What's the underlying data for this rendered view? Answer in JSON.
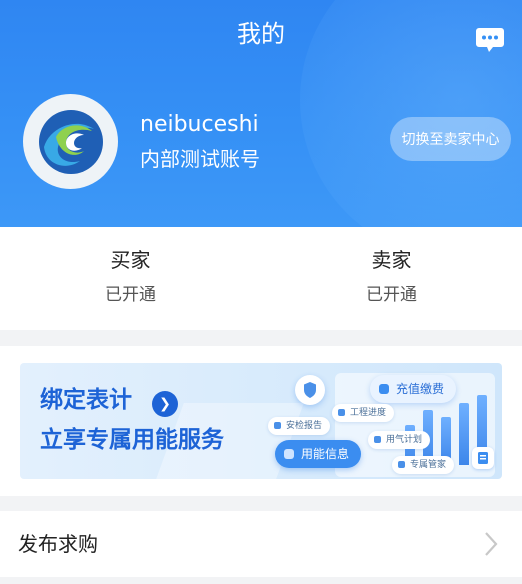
{
  "header": {
    "title": "我的",
    "message_icon": "chat-bubble-icon"
  },
  "profile": {
    "username": "neibuceshi",
    "account_type": "内部测试账号",
    "switch_button_label": "切换至卖家中心",
    "avatar_icon": "company-logo-icon"
  },
  "roles": [
    {
      "name": "买家",
      "status": "已开通"
    },
    {
      "name": "卖家",
      "status": "已开通"
    }
  ],
  "banner": {
    "line1": "绑定表计",
    "line2": "立享专属用能服务",
    "arrow_icon": "chevron-right-icon",
    "tags": {
      "recharge": "充值缴费",
      "safety_report": "安检报告",
      "project_progress": "工程进度",
      "gas_plan": "用气计划",
      "energy_info": "用能信息",
      "dedicated_manager": "专属管家"
    }
  },
  "menu": {
    "publish_purchase": "发布求购",
    "chevron_icon": "chevron-right-icon"
  },
  "colors": {
    "header_blue": "#3590f5",
    "banner_text": "#1d63d6",
    "page_bg": "#f2f3f5"
  }
}
